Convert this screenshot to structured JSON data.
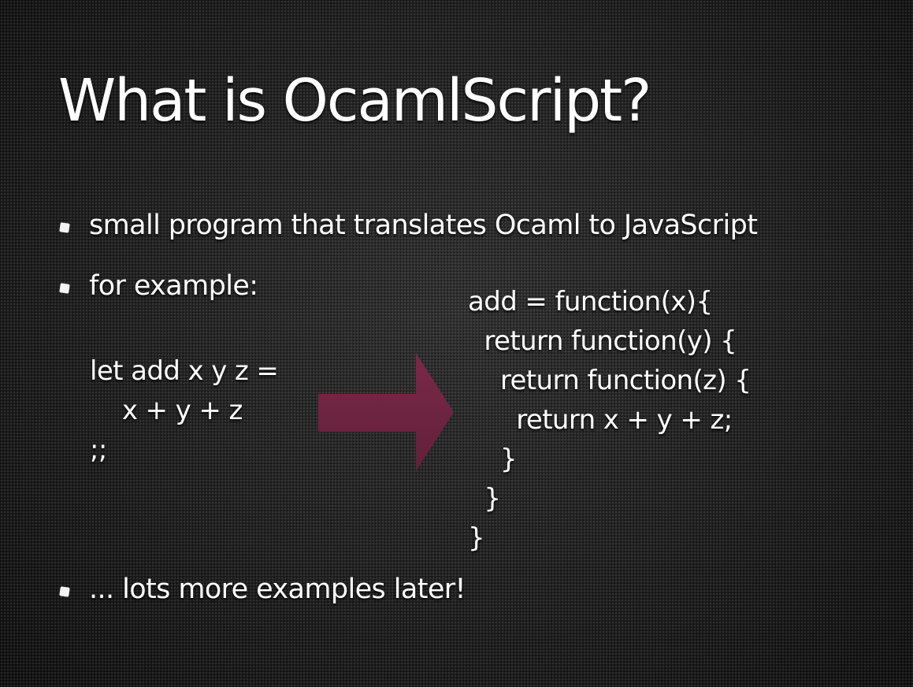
{
  "slide": {
    "title": "What is OcamlScript?",
    "bullets": [
      "small program that translates Ocaml to JavaScript",
      "for example:",
      "... lots more examples later!"
    ],
    "ocaml_code": [
      "let add x y z =",
      "    x + y + z",
      ";;"
    ],
    "js_code": [
      "add = function(x){",
      "  return function(y) {",
      "    return function(z) {",
      "      return x + y + z;",
      "    }",
      "  }",
      "}"
    ],
    "arrow_icon": "right-arrow-icon",
    "colors": {
      "background": "#1b1b1b",
      "text": "#ffffff",
      "arrow": "#6e2340"
    }
  }
}
